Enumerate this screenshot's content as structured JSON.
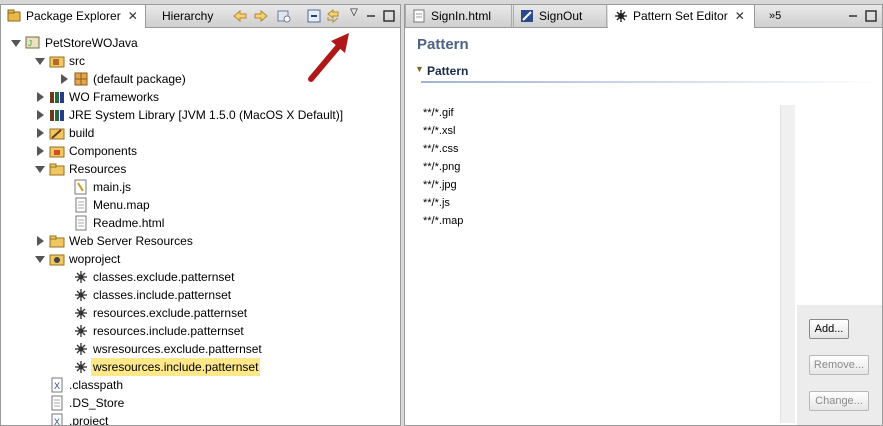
{
  "left_pane": {
    "tabs": [
      {
        "label": "Package Explorer",
        "active": true
      },
      {
        "label": "Hierarchy",
        "active": false
      }
    ],
    "toolbar_icons": [
      "back-icon",
      "forward-icon",
      "link-with-editor-icon",
      "collapse-all-icon",
      "sync-icon",
      "view-menu-icon",
      "minimize-icon",
      "maximize-icon"
    ]
  },
  "tree": [
    {
      "label": "PetStoreWOJava",
      "depth": 0,
      "expanded": true,
      "icon": "project-icon"
    },
    {
      "label": "src",
      "depth": 1,
      "expanded": true,
      "icon": "source-folder-icon"
    },
    {
      "label": "(default package)",
      "depth": 2,
      "expanded": false,
      "icon": "package-icon"
    },
    {
      "label": "WO Frameworks",
      "depth": 1,
      "expanded": false,
      "icon": "library-icon"
    },
    {
      "label": "JRE System Library [JVM 1.5.0 (MacOS X Default)]",
      "depth": 1,
      "expanded": false,
      "icon": "library-icon"
    },
    {
      "label": "build",
      "depth": 1,
      "expanded": false,
      "icon": "build-folder-icon"
    },
    {
      "label": "Components",
      "depth": 1,
      "expanded": false,
      "icon": "components-folder-icon"
    },
    {
      "label": "Resources",
      "depth": 1,
      "expanded": true,
      "icon": "folder-icon"
    },
    {
      "label": "main.js",
      "depth": 2,
      "icon": "js-file-icon"
    },
    {
      "label": "Menu.map",
      "depth": 2,
      "icon": "file-icon"
    },
    {
      "label": "Readme.html",
      "depth": 2,
      "icon": "file-icon"
    },
    {
      "label": "Web Server Resources",
      "depth": 1,
      "expanded": false,
      "icon": "folder-icon"
    },
    {
      "label": "woproject",
      "depth": 1,
      "expanded": true,
      "icon": "woproject-folder-icon"
    },
    {
      "label": "classes.exclude.patternset",
      "depth": 2,
      "icon": "patternset-icon"
    },
    {
      "label": "classes.include.patternset",
      "depth": 2,
      "icon": "patternset-icon"
    },
    {
      "label": "resources.exclude.patternset",
      "depth": 2,
      "icon": "patternset-icon"
    },
    {
      "label": "resources.include.patternset",
      "depth": 2,
      "icon": "patternset-icon"
    },
    {
      "label": "wsresources.exclude.patternset",
      "depth": 2,
      "icon": "patternset-icon"
    },
    {
      "label": "wsresources.include.patternset",
      "depth": 2,
      "icon": "patternset-icon",
      "selected": true
    },
    {
      "label": ".classpath",
      "depth": 1,
      "icon": "xml-file-icon"
    },
    {
      "label": ".DS_Store",
      "depth": 1,
      "icon": "file-icon"
    },
    {
      "label": ".project",
      "depth": 1,
      "icon": "xml-file-icon"
    }
  ],
  "editor": {
    "tabs": [
      {
        "label": "SignIn.html",
        "active": false,
        "icon": "html-file-icon"
      },
      {
        "label": "SignOut",
        "active": false,
        "icon": "wo-component-icon"
      },
      {
        "label": "Pattern Set Editor",
        "active": true,
        "icon": "patternset-icon"
      }
    ],
    "overflow_label": "»5",
    "title": "Pattern",
    "section_label": "Pattern",
    "patterns": [
      "**/*.gif",
      "**/*.xsl",
      "**/*.css",
      "**/*.png",
      "**/*.jpg",
      "**/*.js",
      "**/*.map"
    ],
    "buttons": [
      {
        "label": "Add...",
        "enabled": true
      },
      {
        "label": "Remove...",
        "enabled": false
      },
      {
        "label": "Change...",
        "enabled": false
      }
    ]
  },
  "colors": {
    "annotation_arrow": "#b01818",
    "selection": "#ffe88a",
    "editor_title": "#4c6286"
  }
}
